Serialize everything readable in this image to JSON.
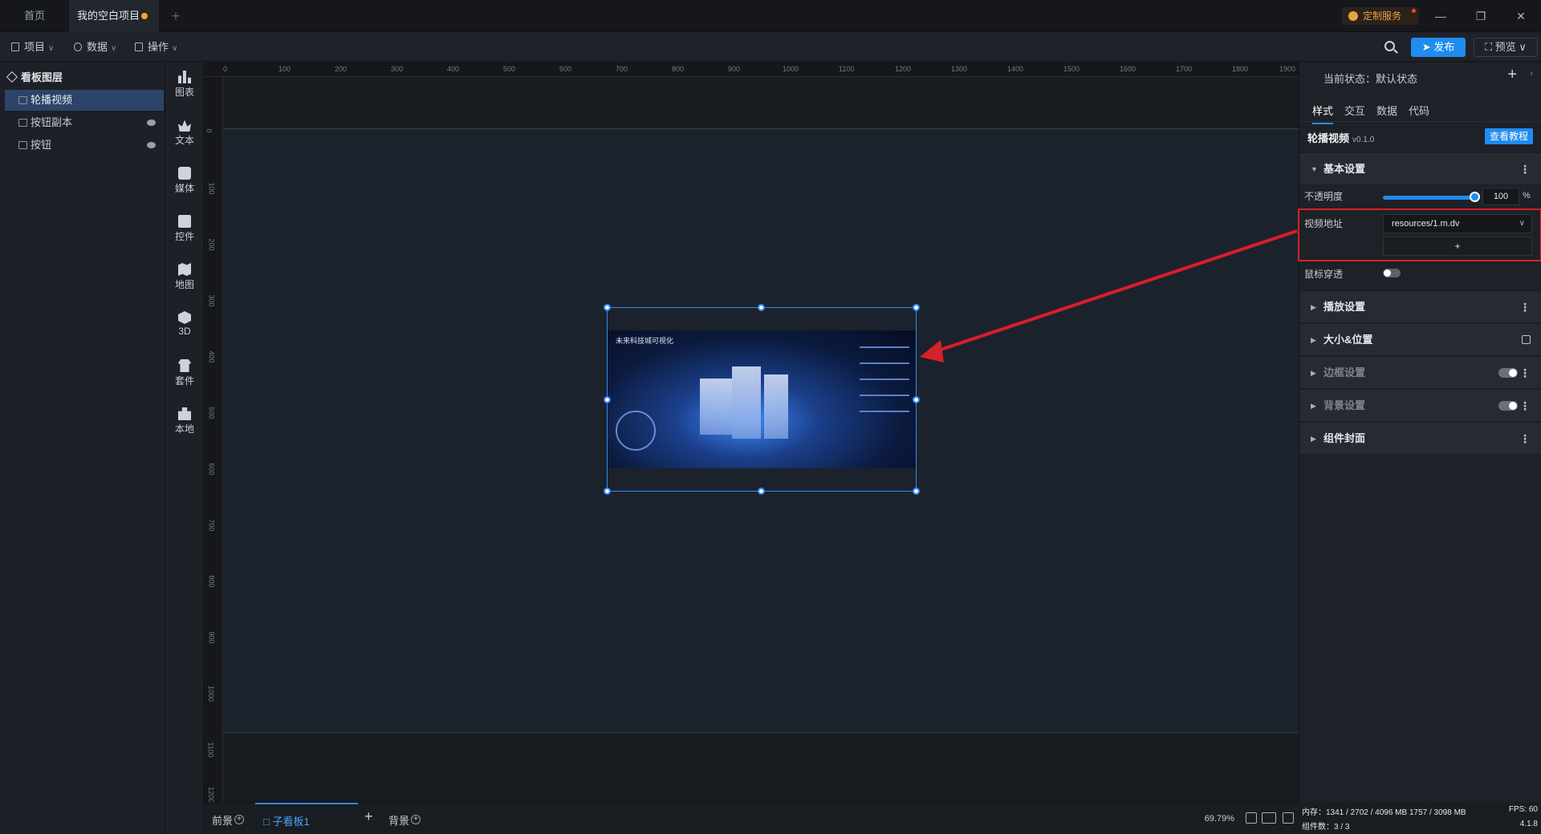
{
  "titlebar": {
    "tabs": [
      "首页",
      "我的空白项目"
    ],
    "custom_service": "定制服务"
  },
  "toolbar": {
    "menus": [
      "项目",
      "数据",
      "操作"
    ],
    "publish": "发布",
    "preview": "预览"
  },
  "layers": {
    "title": "看板图层",
    "items": [
      "轮播视频",
      "按钮副本",
      "按钮"
    ]
  },
  "widgets": [
    "图表",
    "文本",
    "媒体",
    "控件",
    "地图",
    "3D",
    "套件",
    "本地"
  ],
  "ruler": {
    "top": [
      "0",
      "100",
      "200",
      "300",
      "400",
      "500",
      "600",
      "700",
      "800",
      "900",
      "1000",
      "1100",
      "1200",
      "1300",
      "1400",
      "1500",
      "1600",
      "1700",
      "1800",
      "1900"
    ],
    "left": [
      "0",
      "100",
      "200",
      "300",
      "400",
      "500",
      "600",
      "700",
      "800",
      "900",
      "1000",
      "1100",
      "1200"
    ]
  },
  "video": {
    "title": "未来科技城可视化"
  },
  "bottom": {
    "foreground": "前景",
    "sub_board": "子看板1",
    "background": "背景",
    "zoom": "69.79%"
  },
  "props": {
    "state": "当前状态：默认状态",
    "tabs": [
      "样式",
      "交互",
      "数据",
      "代码"
    ],
    "component_name": "轮播视频",
    "component_version": "v0.1.0",
    "tutorial": "查看教程",
    "sections": {
      "basic": "基本设置",
      "play": "播放设置",
      "size": "大小&位置",
      "border": "边框设置",
      "bg": "背景设置",
      "cover": "组件封面"
    },
    "opacity_label": "不透明度",
    "opacity_value": "100",
    "opacity_unit": "%",
    "video_label": "视频地址",
    "video_value": "resources/1.m.dv",
    "add": "+",
    "passthrough_label": "鼠标穿透"
  },
  "status": {
    "memory": "内存：1341 / 2702 / 4096 MB 1757 / 3098 MB",
    "fps": "FPS: 60",
    "count": "组件数：3 / 3",
    "version": "4.1.8"
  },
  "colors": {
    "accent": "#1f8cf0",
    "annotation": "#d6202a",
    "unsaved_dot": "#f5a623"
  }
}
